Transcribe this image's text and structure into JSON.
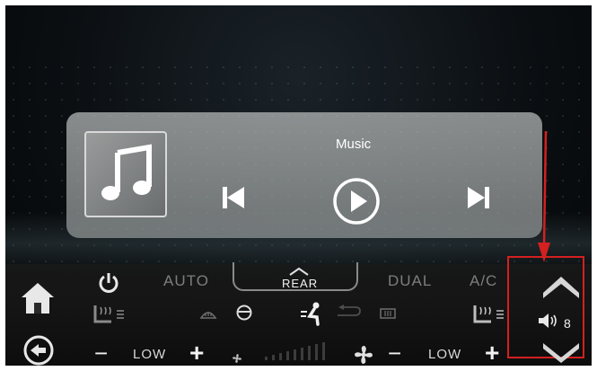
{
  "media": {
    "title": "Music",
    "art_icon": "music-note-icon",
    "controls": [
      "previous-track",
      "play",
      "next-track"
    ]
  },
  "climate": {
    "auto_label": "AUTO",
    "rear_label": "REAR",
    "dual_label": "DUAL",
    "ac_label": "A/C",
    "left_temp": "LOW",
    "right_temp": "LOW",
    "minus": "−",
    "plus": "+",
    "fan_level": 0
  },
  "volume": {
    "value": "8"
  },
  "colors": {
    "annotation_red": "#d42020",
    "inactive_label": "#7d7d7d",
    "active": "#f2f2f2"
  }
}
